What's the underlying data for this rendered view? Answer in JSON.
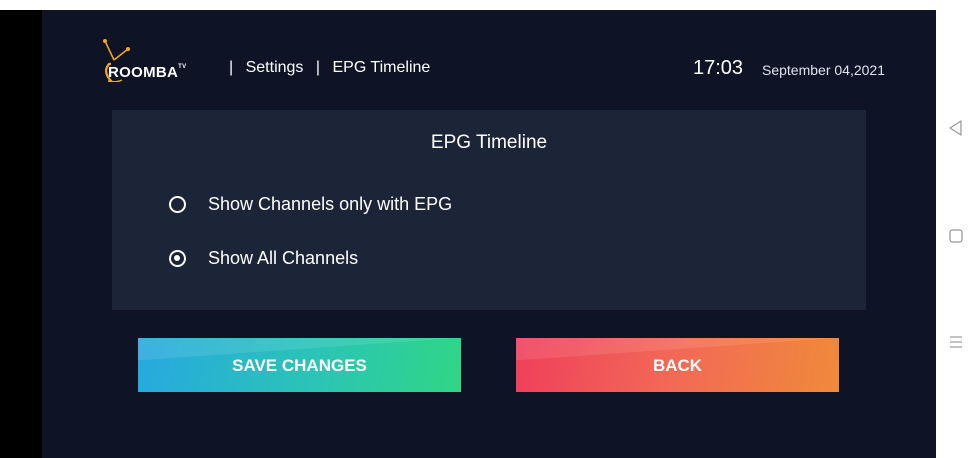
{
  "header": {
    "logo_text": "ROOMBA",
    "logo_tm": "TV",
    "breadcrumb": [
      "|",
      "Settings",
      "|",
      "EPG Timeline"
    ],
    "time": "17:03",
    "date": "September 04,2021"
  },
  "panel": {
    "title": "EPG Timeline",
    "options": [
      {
        "label": "Show Channels only with EPG",
        "selected": false
      },
      {
        "label": "Show All Channels",
        "selected": true
      }
    ]
  },
  "buttons": {
    "save_label": "SAVE CHANGES",
    "back_label": "BACK"
  },
  "colors": {
    "background": "#0e1326",
    "panel": "#1c2538",
    "logo_accent": "#f5a623"
  },
  "navigation_icons": [
    "back-triangle-icon",
    "home-square-icon",
    "menu-lines-icon"
  ]
}
